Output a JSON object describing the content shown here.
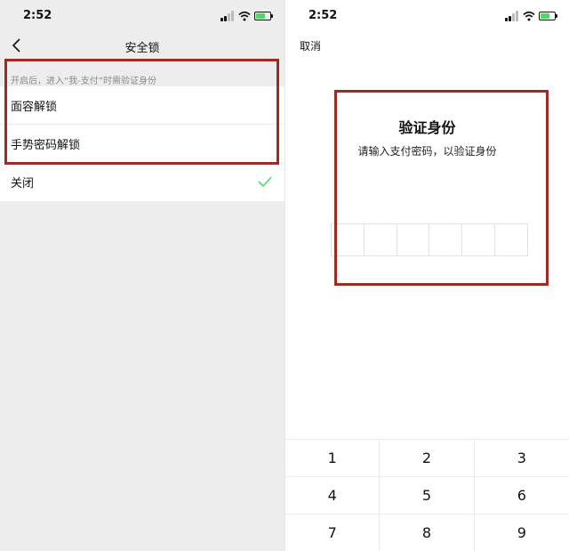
{
  "left": {
    "status": {
      "time": "2:52"
    },
    "nav": {
      "title": "安全锁",
      "back_icon": "chevron-left-icon"
    },
    "hint": "开启后，进入“我-支付”时需验证身份",
    "options": [
      {
        "label": "面容解锁",
        "selected": false
      },
      {
        "label": "手势密码解锁",
        "selected": false
      },
      {
        "label": "关闭",
        "selected": true
      }
    ],
    "check_color": "#4cd964"
  },
  "right": {
    "status": {
      "time": "2:52"
    },
    "cancel": "取消",
    "dialog": {
      "title": "验证身份",
      "subtitle": "请输入支付密码，以验证身份",
      "pin_length": 6
    },
    "keypad": [
      "1",
      "2",
      "3",
      "4",
      "5",
      "6",
      "7",
      "8",
      "9"
    ]
  },
  "highlight_color": "#9e2b23"
}
